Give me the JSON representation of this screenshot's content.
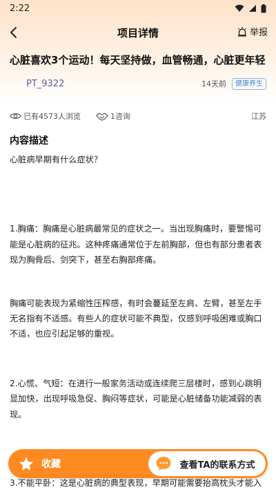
{
  "status_bar": {
    "time": "2:22"
  },
  "nav": {
    "title": "项目详情",
    "report_label": "举报"
  },
  "post": {
    "title": "心脏喜欢3个运动！每天坚持做，血管畅通，心脏更年轻",
    "author": "PT_9322",
    "time_ago": "14天前",
    "tag": "健康养生",
    "views": "已有4573人浏览",
    "consults": "1咨询",
    "location": "江苏"
  },
  "content": {
    "section_title": "内容描述",
    "question": "心脏病早期有什么症状？",
    "para1": "1.胸痛：胸痛是心脏病最常见的症状之一。当出现胸痛时，要警惕可能是心脏病的征兆。这种疼痛通常位于左前胸部，但也有部分患者表现为胸骨后、剑突下，甚至右胸部疼痛。",
    "para2": "胸痛可能表现为紧缩性压榨感，有时会蔓延至左肩、左臂，甚至左手无名指有不适感。有些人的症状可能不典型，仅感到呼吸困难或胸口不适，也应引起足够的重视。",
    "para3": "2.心慌、气短：在进行一般家务活动或连续爬三层楼时，感到心跳明显加快，出现呼吸急促、胸闷等症状，可能是心脏储备功能减弱的表现。",
    "para4": "3.不能平卧：这是心脏病的典型表现，早期可能需要抬高枕头才能入"
  },
  "bottom_bar": {
    "favorite_label": "收藏",
    "contact_label": "查看TA的联系方式"
  },
  "colors": {
    "accent": "#ff8a22",
    "tag_blue": "#3a8ed8",
    "author": "#5a5fa8"
  }
}
